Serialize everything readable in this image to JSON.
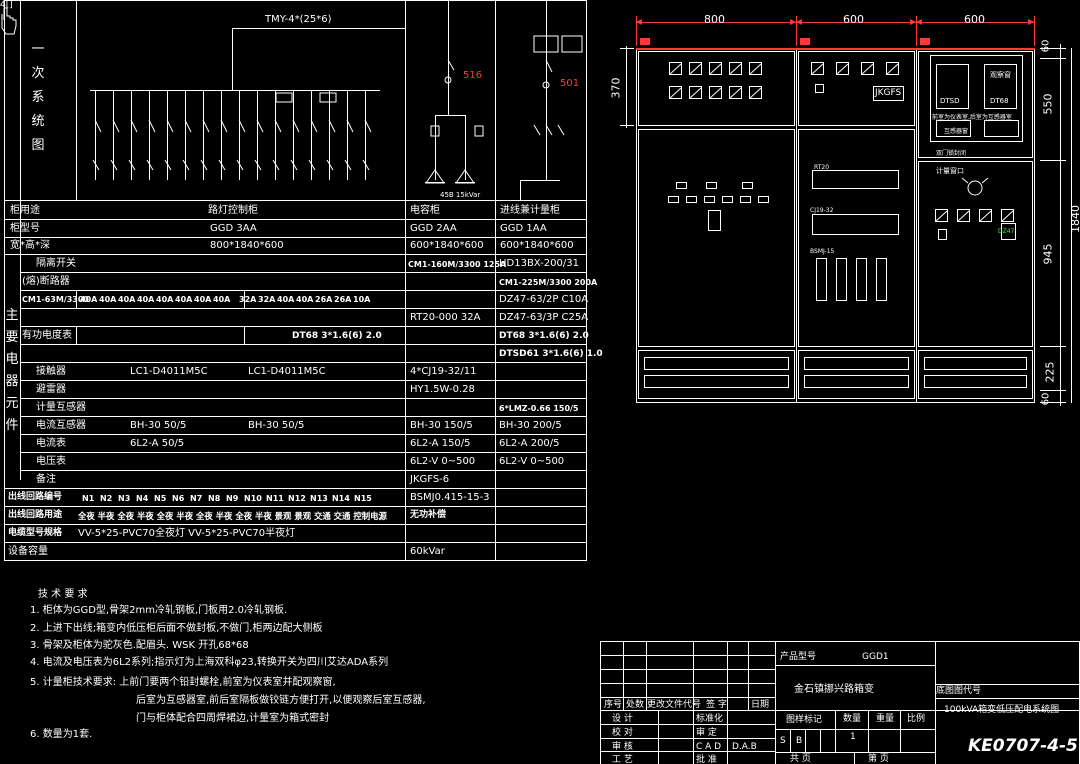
{
  "primary_system_label": [
    "一",
    "次",
    "系",
    "统",
    "图"
  ],
  "main_components_label": [
    "主",
    "要",
    "电",
    "器",
    "元",
    "件"
  ],
  "corner_tab": "4[]",
  "busbar_label": "TMY-4*(25*6)",
  "capacitor_tag": "516",
  "incoming_tag": "501",
  "capacitor_rating": "45B  15kVar",
  "rows": {
    "purpose": {
      "label": "柜用途",
      "lighting": "路灯控制柜",
      "capacitor": "电容柜",
      "incoming": "进线兼计量柜"
    },
    "model": {
      "label": "柜型号",
      "lighting": "GGD   3AA",
      "capacitor": "GGD   2AA",
      "incoming": "GGD   1AA"
    },
    "size": {
      "label": "宽*高*深",
      "lighting": "800*1840*600",
      "capacitor": "600*1840*600",
      "incoming": "600*1840*600"
    },
    "isolator": {
      "label": "隔离开关",
      "capacitor": "CM1-160M/3300 125A",
      "incoming": "HD13BX-200/31"
    },
    "breaker": {
      "label": "(熔)断路器",
      "incoming": "CM1-225M/3300 200A"
    },
    "cm1": {
      "label": "CM1-63M/3300",
      "currents": [
        "40A",
        "40A",
        "40A",
        "40A",
        "40A",
        "40A",
        "40A",
        "40A",
        "32A",
        "32A",
        "40A",
        "40A",
        "26A",
        "26A",
        "10A"
      ],
      "incoming": "DZ47-63/2P C10A"
    },
    "fuse": {
      "capacitor": "RT20-000 32A",
      "incoming": "DZ47-63/3P C25A"
    },
    "active_meter": {
      "label": "有功电度表",
      "lighting": "DT68 3*1.6(6) 2.0",
      "incoming": "DT68 3*1.6(6) 2.0"
    },
    "dtsd": {
      "incoming": "DTSD61 3*1.6(6) 1.0"
    },
    "contactor": {
      "label": "接触器",
      "lighting_a": "LC1-D4011M5C",
      "lighting_b": "LC1-D4011M5C",
      "capacitor": "4*CJ19-32/11"
    },
    "arrester": {
      "label": "避雷器",
      "capacitor": "HY1.5W-0.28"
    },
    "metering_ct": {
      "label": "计量互感器",
      "incoming": "6*LMZ-0.66 150/5"
    },
    "ct": {
      "label": "电流互感器",
      "lighting_a": "BH-30  50/5",
      "lighting_b": "BH-30  50/5",
      "capacitor": "BH-30  150/5",
      "incoming": "BH-30  200/5"
    },
    "ammeter": {
      "label": "电流表",
      "lighting": "6L2-A  50/5",
      "capacitor": "6L2-A  150/5",
      "incoming": "6L2-A  200/5"
    },
    "voltmeter": {
      "label": "电压表",
      "capacitor": "6L2-V 0~500",
      "incoming": "6L2-V 0~500"
    },
    "note": {
      "label": "备注",
      "capacitor": "JKGFS-6"
    },
    "circuit_no": {
      "label": "出线回路编号",
      "circuits": [
        "N1",
        "N2",
        "N3",
        "N4",
        "N5",
        "N6",
        "N7",
        "N8",
        "N9",
        "N10",
        "N11",
        "N12",
        "N13",
        "N14",
        "N15"
      ],
      "capacitor": "BSMJ0.415-15-3"
    },
    "circuit_use": {
      "label": "出线回路用途",
      "lighting": "全夜 半夜 全夜 半夜 全夜 半夜 全夜 半夜 全夜 半夜 景观 景观 交通 交通  控制电源",
      "capacitor": "无功补偿"
    },
    "cable": {
      "label": "电缆型号规格",
      "lighting": "VV-5*25-PVC70全夜灯  VV-5*25-PVC70半夜灯"
    },
    "capacity": {
      "label": "设备容量",
      "capacitor": "60kVar"
    }
  },
  "elevation": {
    "widths": [
      "800",
      "600",
      "600"
    ],
    "heights_left": [
      "370"
    ],
    "heights_right": [
      "60",
      "550",
      "945",
      "225",
      "60"
    ],
    "total_height": "1840",
    "panel2_labels": {
      "jkgfs": "JKGFS",
      "rt20": "RT20",
      "cj19": "CJ19-32",
      "bsmj": "BSMJ-15"
    },
    "panel3_labels": {
      "meter1": "DTSD",
      "meter2": "DT68",
      "window": "观察窗",
      "door": "计量窗口",
      "fcn": "互感器窗",
      "window_note": "前室为仪表室,后室为互感器室",
      "lock": "双门锁封闭",
      "dz": "DZ47"
    }
  },
  "tech": {
    "title": "技 术 要 求",
    "items": [
      "1.  柜体为GGD型,骨架2mm冷轧钢板,门板用2.0冷轧钢板.",
      "2.  上进下出线;箱变内低压柜后面不做封板,不做门,柜两边配大侧板",
      "3.  骨架及柜体为驼灰色.配眉头.  WSK 开孔68*68",
      "4.  电流及电压表为6L2系列;指示灯为上海双科φ23,转换开关为四川艾达ADA系列",
      "5.  计量柜技术要求:  上前门要两个铅封螺栓,前室为仪表室并配观察窗,",
      "后室为互感器室,前后室隔板做铰链方便打开,以便观察后室互感器,",
      "门与柜体配合四周焊裙边,计量室为箱式密封",
      "6.  数量为1套."
    ]
  },
  "titleblock": {
    "product_code_label": "产品型号",
    "product_code": "GGD1",
    "project": "金石镇挪兴路箱变",
    "drawing_code_label": "底图图代号",
    "drawing_name": "100kVA箱变低压配电系统图",
    "drawing_no": "KE0707-4-5",
    "rev_cols": [
      "序号",
      "处数",
      "更改文件代号",
      "签  字",
      "日期"
    ],
    "roles": [
      "设  计",
      "校  对",
      "审  核",
      "工  艺"
    ],
    "roles2": [
      "标准化",
      "审  定",
      "C A D",
      "批  准"
    ],
    "dab": "D.A.B",
    "stage_label": "图样标记",
    "qty_label": "数量",
    "weight_label": "重量",
    "scale_label": "比例",
    "stage_s": "S",
    "stage_b": "B",
    "qty": "1",
    "sheets_label": "共     页",
    "sheet_label": "第     页"
  }
}
